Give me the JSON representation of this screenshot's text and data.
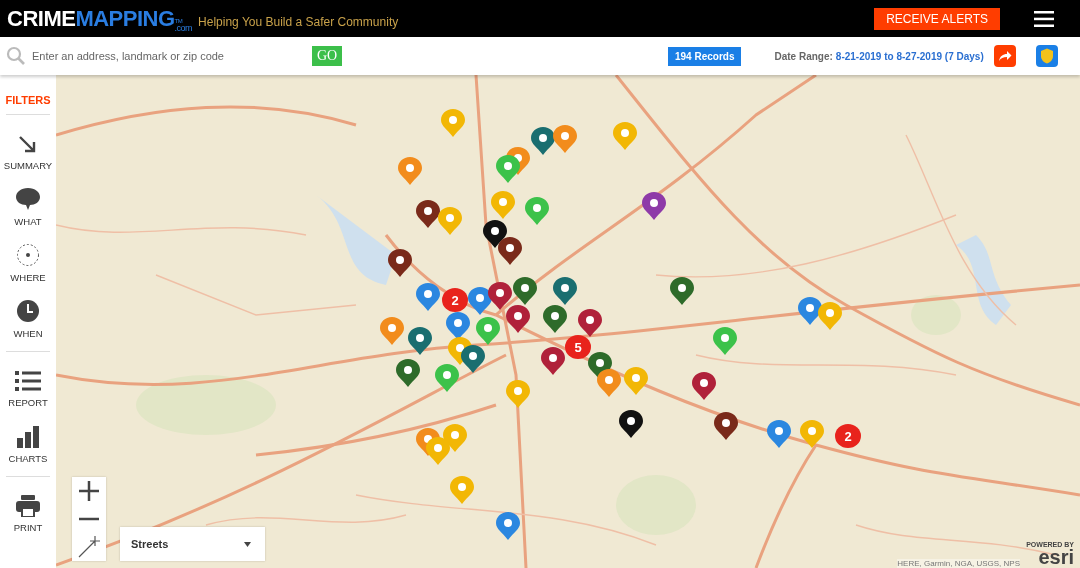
{
  "header": {
    "logo": {
      "first": "CRIME",
      "second": "MAPPING",
      "mark": "TM",
      "suffix": ".com"
    },
    "tagline": "Helping You Build a Safer Community",
    "alerts_button": "RECEIVE ALERTS"
  },
  "toolbar": {
    "search": {
      "placeholder": "Enter an address, landmark or zip code"
    },
    "go_button": "GO",
    "records": "194 Records",
    "date_label": "Date Range:",
    "date_value": "8-21-2019 to 8-27-2019 (7 Days)"
  },
  "sidebar": {
    "title": "FILTERS",
    "items": [
      {
        "kind": "summary",
        "label": "SUMMARY"
      },
      {
        "kind": "what",
        "label": "WHAT"
      },
      {
        "kind": "where",
        "label": "WHERE"
      },
      {
        "kind": "when",
        "label": "WHEN"
      },
      {
        "kind": "report",
        "label": "REPORT"
      },
      {
        "kind": "charts",
        "label": "CHARTS"
      },
      {
        "kind": "print",
        "label": "PRINT"
      }
    ]
  },
  "map": {
    "markers": [
      {
        "kind": "pin",
        "color": "#f2b705"
      },
      {
        "kind": "pin",
        "color": "#f28c1c"
      },
      {
        "kind": "pin",
        "color": "#1a6e70"
      },
      {
        "kind": "pin",
        "color": "#f28c1c"
      },
      {
        "kind": "pin",
        "color": "#f28c1c"
      },
      {
        "kind": "pin",
        "color": "#f2b705"
      },
      {
        "kind": "pin",
        "color": "#3cc24a"
      },
      {
        "kind": "pin",
        "color": "#7a2a1a"
      },
      {
        "kind": "pin",
        "color": "#f2b705"
      },
      {
        "kind": "pin",
        "color": "#f2b705"
      },
      {
        "kind": "pin",
        "color": "#3cc24a"
      },
      {
        "kind": "pin",
        "color": "#8e3aa8"
      },
      {
        "kind": "pin",
        "color": "#111111"
      },
      {
        "kind": "pin",
        "color": "#7a2a1a"
      },
      {
        "kind": "pin",
        "color": "#7a2a1a"
      },
      {
        "kind": "pin",
        "color": "#2b87e0"
      },
      {
        "kind": "cluster",
        "count": "2"
      },
      {
        "kind": "pin",
        "color": "#2b87e0"
      },
      {
        "kind": "pin",
        "color": "#b0213a"
      },
      {
        "kind": "pin",
        "color": "#2e6b2a"
      },
      {
        "kind": "pin",
        "color": "#1a6e70"
      },
      {
        "kind": "pin",
        "color": "#b0213a"
      },
      {
        "kind": "pin",
        "color": "#2e6b2a"
      },
      {
        "kind": "pin",
        "color": "#f28c1c"
      },
      {
        "kind": "pin",
        "color": "#1a6e70"
      },
      {
        "kind": "pin",
        "color": "#2b87e0"
      },
      {
        "kind": "pin",
        "color": "#3cc24a"
      },
      {
        "kind": "pin",
        "color": "#b0213a"
      },
      {
        "kind": "pin",
        "color": "#2e6b2a"
      },
      {
        "kind": "cluster",
        "count": "5"
      },
      {
        "kind": "pin",
        "color": "#b0213a"
      },
      {
        "kind": "pin",
        "color": "#2e6b2a"
      },
      {
        "kind": "pin",
        "color": "#f2b705"
      },
      {
        "kind": "pin",
        "color": "#1a6e70"
      },
      {
        "kind": "pin",
        "color": "#2e6b2a"
      },
      {
        "kind": "pin",
        "color": "#3cc24a"
      },
      {
        "kind": "pin",
        "color": "#f2b705"
      },
      {
        "kind": "pin",
        "color": "#f28c1c"
      },
      {
        "kind": "pin",
        "color": "#f2b705"
      },
      {
        "kind": "pin",
        "color": "#b0213a"
      },
      {
        "kind": "pin",
        "color": "#111111"
      },
      {
        "kind": "pin",
        "color": "#7a2a1a"
      },
      {
        "kind": "pin",
        "color": "#2b87e0"
      },
      {
        "kind": "pin",
        "color": "#f2b705"
      },
      {
        "kind": "cluster",
        "count": "2"
      },
      {
        "kind": "pin",
        "color": "#2b87e0"
      },
      {
        "kind": "pin",
        "color": "#f2b705"
      },
      {
        "kind": "pin",
        "color": "#3cc24a"
      },
      {
        "kind": "pin",
        "color": "#f28c1c"
      },
      {
        "kind": "pin",
        "color": "#f2b705"
      },
      {
        "kind": "pin",
        "color": "#f2b705"
      },
      {
        "kind": "pin",
        "color": "#f2b705"
      },
      {
        "kind": "pin",
        "color": "#2b87e0"
      }
    ],
    "basemap": "Streets",
    "powered_by": "POWERED BY",
    "logo": "esri",
    "attribution": "HERE, Garmin, NGA, USGS, NPS"
  }
}
